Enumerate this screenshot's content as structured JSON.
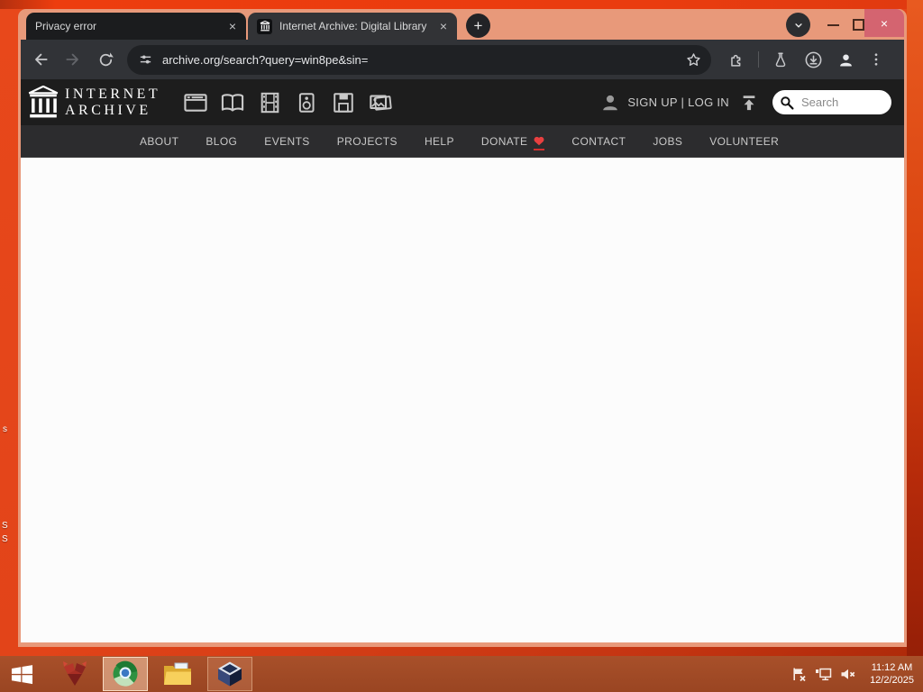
{
  "browser": {
    "tabs": [
      {
        "title": "Privacy error"
      },
      {
        "title": "Internet Archive: Digital Library"
      }
    ],
    "close_glyph": "×",
    "new_tab_glyph": "+",
    "url": "archive.org/search?query=win8pe&sin="
  },
  "ia": {
    "logo": {
      "line1": "INTERNET",
      "line2": "ARCHIVE"
    },
    "auth": "SIGN UP | LOG IN",
    "search_placeholder": "Search",
    "nav": [
      {
        "label": "ABOUT"
      },
      {
        "label": "BLOG"
      },
      {
        "label": "EVENTS"
      },
      {
        "label": "PROJECTS"
      },
      {
        "label": "HELP"
      },
      {
        "label": "DONATE"
      },
      {
        "label": "CONTACT"
      },
      {
        "label": "JOBS"
      },
      {
        "label": "VOLUNTEER"
      }
    ]
  },
  "taskbar": {
    "clock": {
      "time": "11:12 AM",
      "date": "12/2/2025"
    }
  },
  "desktop": {
    "fragments": [
      {
        "text": "s"
      },
      {
        "text": "S"
      },
      {
        "text": "S"
      }
    ]
  },
  "icons": {
    "tab_favicon": "internet-archive-building",
    "media": [
      "web",
      "texts",
      "video",
      "audio",
      "software",
      "images"
    ],
    "donate_heart_color": "#e84040"
  },
  "colors": {
    "frame": "#e8997a",
    "toolbar": "#313337",
    "desktop": "#e2491b",
    "close_button": "#d46470",
    "content": "#fcfcfc"
  }
}
